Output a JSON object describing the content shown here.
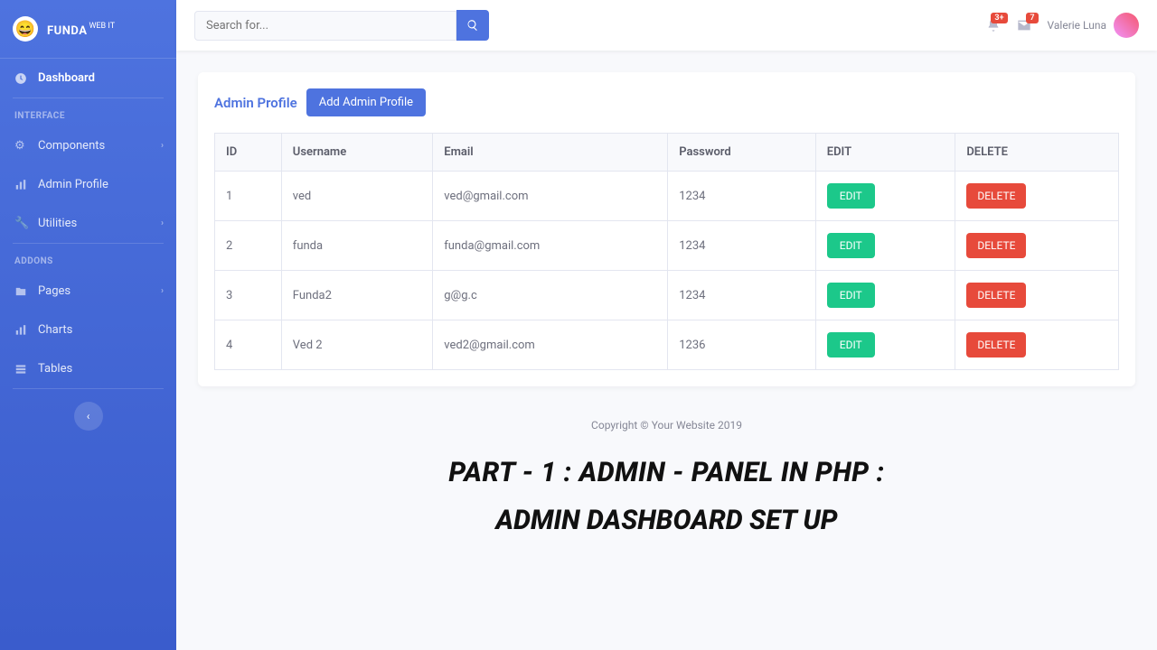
{
  "brand": {
    "name": "FUNDA",
    "sup": "WEB IT"
  },
  "sidebar": {
    "dashboard": "Dashboard",
    "heading1": "INTERFACE",
    "components": "Components",
    "adminProfile": "Admin Profile",
    "utilities": "Utilities",
    "heading2": "ADDONS",
    "pages": "Pages",
    "charts": "Charts",
    "tables": "Tables"
  },
  "search": {
    "placeholder": "Search for..."
  },
  "notifBell": "3+",
  "notifMail": "7",
  "userName": "Valerie Luna",
  "page": {
    "title": "Admin Profile",
    "addBtn": "Add Admin Profile"
  },
  "table": {
    "headers": [
      "ID",
      "Username",
      "Email",
      "Password",
      "EDIT",
      "DELETE"
    ],
    "editLabel": "EDIT",
    "deleteLabel": "DELETE",
    "rows": [
      {
        "id": "1",
        "username": "ved",
        "email": "ved@gmail.com",
        "password": "1234"
      },
      {
        "id": "2",
        "username": "funda",
        "email": "funda@gmail.com",
        "password": "1234"
      },
      {
        "id": "3",
        "username": "Funda2",
        "email": "g@g.c",
        "password": "1234"
      },
      {
        "id": "4",
        "username": "Ved 2",
        "email": "ved2@gmail.com",
        "password": "1236"
      }
    ]
  },
  "footer": "Copyright © Your Website 2019",
  "banner": {
    "line1": "PART - 1 :  ADMIN - PANEL IN PHP :",
    "line2": "ADMIN DASHBOARD SET UP"
  }
}
